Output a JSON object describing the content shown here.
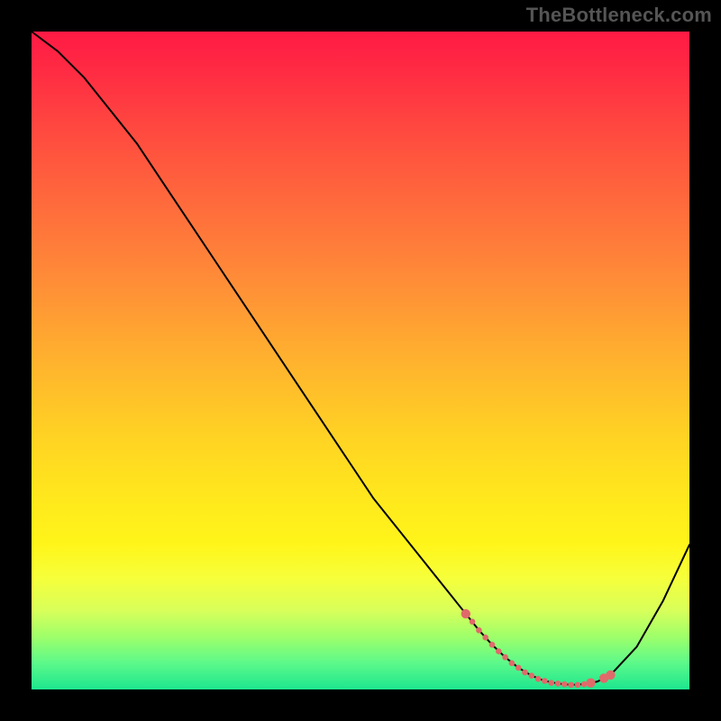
{
  "watermark": "TheBottleneck.com",
  "chart_data": {
    "type": "line",
    "title": "",
    "xlabel": "",
    "ylabel": "",
    "xlim": [
      0,
      100
    ],
    "ylim": [
      0,
      100
    ],
    "grid": false,
    "legend": false,
    "series": [
      {
        "name": "curve",
        "x": [
          0,
          4,
          8,
          12,
          16,
          20,
          24,
          28,
          32,
          36,
          40,
          44,
          48,
          52,
          56,
          60,
          64,
          66,
          68,
          70,
          72,
          74,
          76,
          78,
          80,
          82,
          84,
          86,
          88,
          92,
          96,
          100
        ],
        "y": [
          100,
          97,
          93,
          88,
          83,
          77,
          71,
          65,
          59,
          53,
          47,
          41,
          35,
          29,
          24,
          19,
          14,
          11.5,
          9,
          6.8,
          4.9,
          3.3,
          2.1,
          1.3,
          0.9,
          0.7,
          0.8,
          1.2,
          2.2,
          6.5,
          13.5,
          22
        ],
        "color": "#000000",
        "width": 2
      }
    ],
    "markers": {
      "name": "highlight-region",
      "color": "#e06a6a",
      "radius_small": 3.3,
      "radius_large": 5.2,
      "points": [
        {
          "x": 66,
          "y": 11.5,
          "r": "large"
        },
        {
          "x": 67,
          "y": 10.3,
          "r": "small"
        },
        {
          "x": 68,
          "y": 9.0,
          "r": "small"
        },
        {
          "x": 69,
          "y": 7.9,
          "r": "small"
        },
        {
          "x": 70,
          "y": 6.8,
          "r": "small"
        },
        {
          "x": 71,
          "y": 5.8,
          "r": "small"
        },
        {
          "x": 72,
          "y": 4.9,
          "r": "small"
        },
        {
          "x": 73,
          "y": 4.0,
          "r": "small"
        },
        {
          "x": 74,
          "y": 3.3,
          "r": "small"
        },
        {
          "x": 75,
          "y": 2.6,
          "r": "small"
        },
        {
          "x": 76,
          "y": 2.1,
          "r": "small"
        },
        {
          "x": 77,
          "y": 1.6,
          "r": "small"
        },
        {
          "x": 78,
          "y": 1.3,
          "r": "small"
        },
        {
          "x": 79,
          "y": 1.0,
          "r": "small"
        },
        {
          "x": 80,
          "y": 0.9,
          "r": "small"
        },
        {
          "x": 81,
          "y": 0.8,
          "r": "small"
        },
        {
          "x": 82,
          "y": 0.7,
          "r": "small"
        },
        {
          "x": 83,
          "y": 0.7,
          "r": "small"
        },
        {
          "x": 84,
          "y": 0.8,
          "r": "small"
        },
        {
          "x": 85,
          "y": 1.0,
          "r": "large"
        },
        {
          "x": 87,
          "y": 1.7,
          "r": "large"
        },
        {
          "x": 88,
          "y": 2.2,
          "r": "large"
        }
      ]
    }
  }
}
